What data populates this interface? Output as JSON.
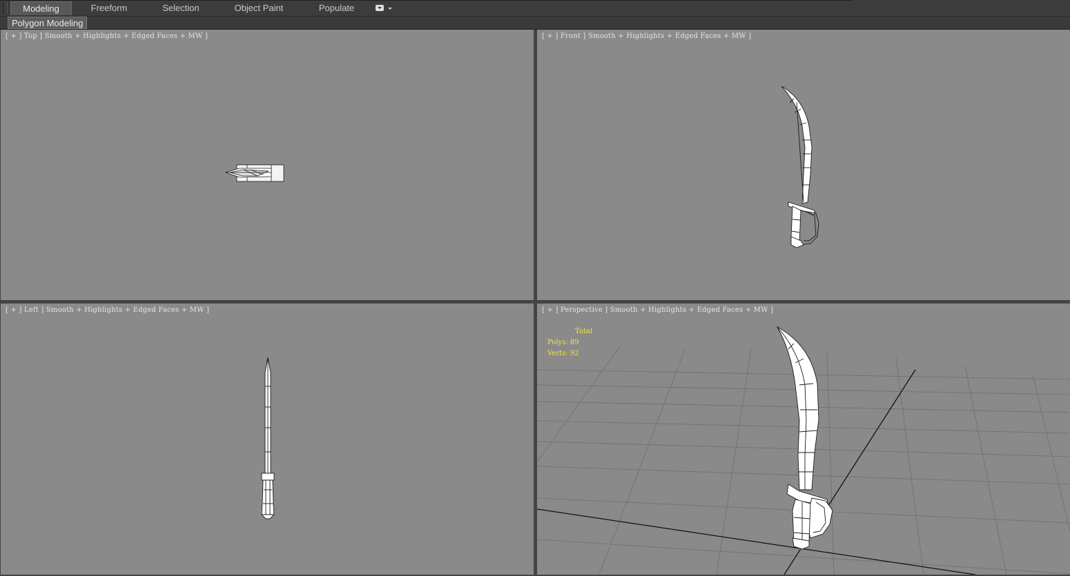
{
  "ribbon": {
    "tabs": [
      {
        "label": "Modeling",
        "active": true
      },
      {
        "label": "Freeform",
        "active": false
      },
      {
        "label": "Selection",
        "active": false
      },
      {
        "label": "Object Paint",
        "active": false
      },
      {
        "label": "Populate",
        "active": false
      }
    ],
    "panel_label": "Polygon Modeling",
    "tab_menu_icon": "dropdown-menu-icon"
  },
  "viewports": {
    "top": {
      "label": "[ + ] Top ] Smooth + Highlights + Edged Faces + MW ]"
    },
    "front": {
      "label": "[ + ] Front ] Smooth + Highlights + Edged Faces + MW ]"
    },
    "left": {
      "label": "[ + ] Left ] Smooth + Highlights + Edged Faces + MW ]"
    },
    "perspective": {
      "label": "[ + ] Perspective ] Smooth + Highlights + Edged Faces + MW ]"
    }
  },
  "stats": {
    "header": "Total",
    "polys": "Polys: 89",
    "verts": "Verts: 92"
  },
  "colors": {
    "viewport_bg": "#8a8a8a",
    "ui_dark": "#3c3c3c",
    "stats_text": "#f0e63c",
    "mesh_fill": "#ffffff",
    "mesh_edge": "#1a1a1a"
  }
}
